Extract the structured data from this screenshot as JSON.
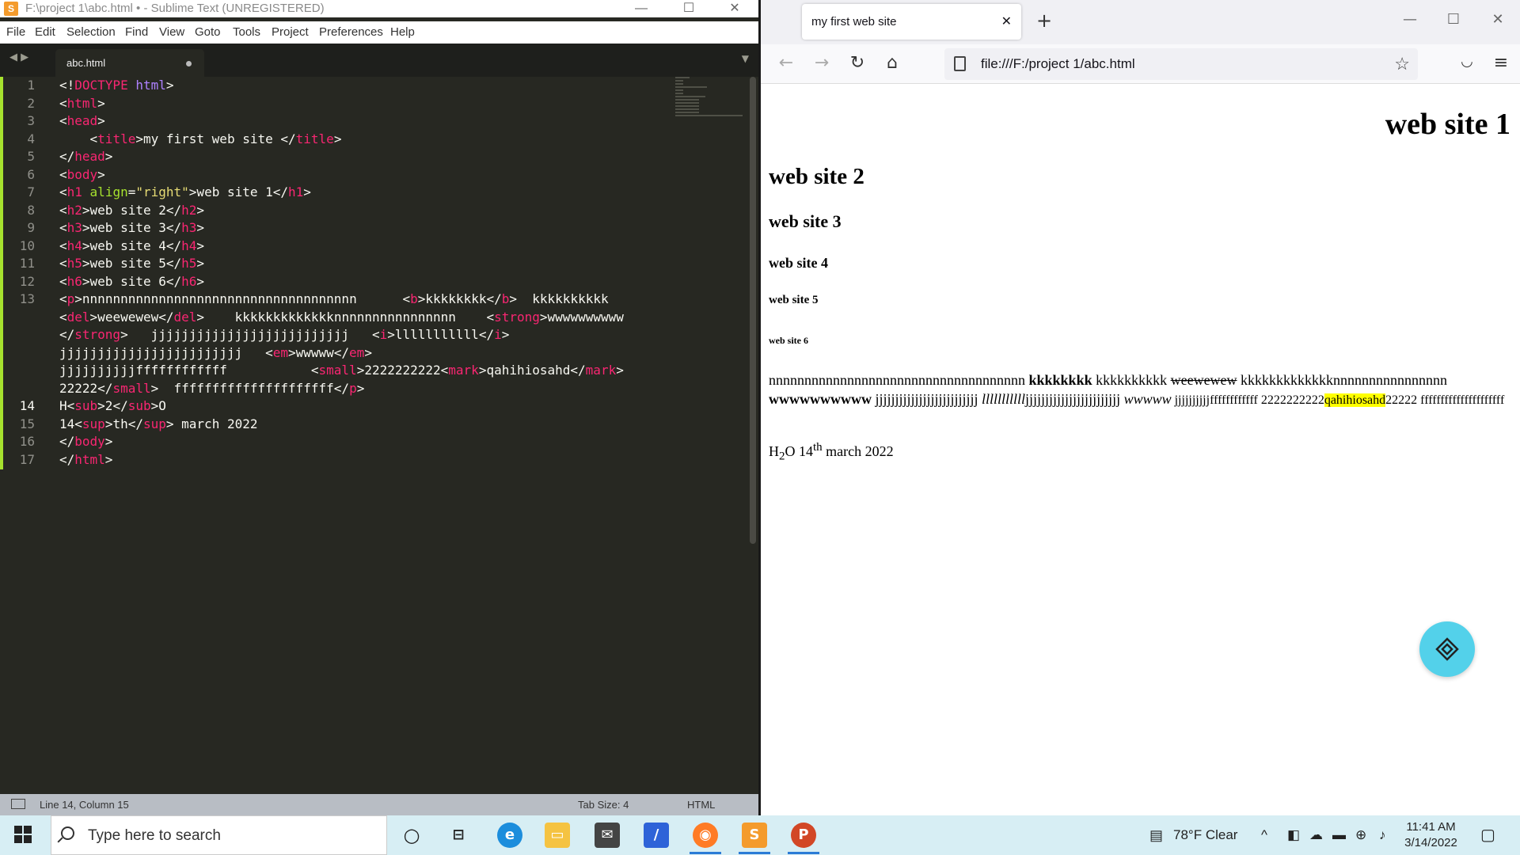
{
  "sublime": {
    "title": "F:\\project 1\\abc.html • - Sublime Text (UNREGISTERED)",
    "menu": [
      "File",
      "Edit",
      "Selection",
      "Find",
      "View",
      "Goto",
      "Tools",
      "Project",
      "Preferences",
      "Help"
    ],
    "tab": "abc.html",
    "line_numbers": [
      "1",
      "2",
      "3",
      "4",
      "5",
      "6",
      "7",
      "8",
      "9",
      "10",
      "11",
      "12",
      "13",
      "",
      "",
      "",
      "",
      "",
      "14",
      "15",
      "16",
      "17"
    ],
    "status_position": "Line 14, Column 15",
    "tab_size": "Tab Size: 4",
    "syntax": "HTML"
  },
  "firefox": {
    "tab_title": "my first web site",
    "url": "file:///F:/project 1/abc.html",
    "page": {
      "h1": "web site 1",
      "h2": "web site 2",
      "h3": "web site 3",
      "h4": "web site 4",
      "h5": "web site 5",
      "h6": "web site 6",
      "p_n": "nnnnnnnnnnnnnnnnnnnnnnnnnnnnnnnnnnnn ",
      "p_b": "kkkkkkkk",
      "p_k": " kkkkkkkkkk ",
      "p_del": "weewewew",
      "p_k2": " kkkkkkkkkkkkknnnnnnnnnnnnnnnn ",
      "p_strong": "wwwwwwwwww",
      "p_j": " jjjjjjjjjjjjjjjjjjjjjjjjjj ",
      "p_i": "lllllllllll",
      "p_j2": "jjjjjjjjjjjjjjjjjjjjjjjj ",
      "p_em": "wwwww",
      "p_j3": " jjjjjjjjjjffffffffffff 2222222222",
      "p_mark": "qahihiosahd",
      "p_end": "22222 fffffffffffffffffffff",
      "h": "H",
      "sub": "2",
      "o": "O 14",
      "sup": "th",
      "date": " march 2022"
    }
  },
  "taskbar": {
    "search_placeholder": "Type here to search",
    "weather": "78°F  Clear",
    "time": "11:41 AM",
    "date": "3/14/2022"
  }
}
